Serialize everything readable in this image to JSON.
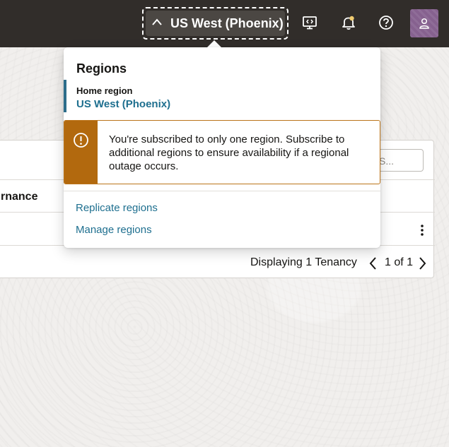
{
  "header": {
    "region_button_label": "US West (Phoenix)",
    "icons": [
      "chevron-up-icon",
      "cloud-shell-icon",
      "bell-icon",
      "help-icon",
      "user-icon"
    ],
    "notification_dot_color": "#f0cc71"
  },
  "background_card": {
    "search_placeholder": "S...",
    "column_header": "rnance",
    "footer_text": "Displaying 1 Tenancy",
    "pagination_text": "1 of 1"
  },
  "popup": {
    "title": "Regions",
    "home_region_label": "Home region",
    "home_region_value": "US West (Phoenix)",
    "warning_text": "You're subscribed to only one region. Subscribe to additional regions to ensure availability if a regional outage occurs.",
    "links": [
      "Replicate regions",
      "Manage regions"
    ]
  },
  "colors": {
    "header_bg": "#312d2a",
    "link": "#1e6f8f",
    "warning": "#b2690e",
    "avatar": "#86618f"
  }
}
